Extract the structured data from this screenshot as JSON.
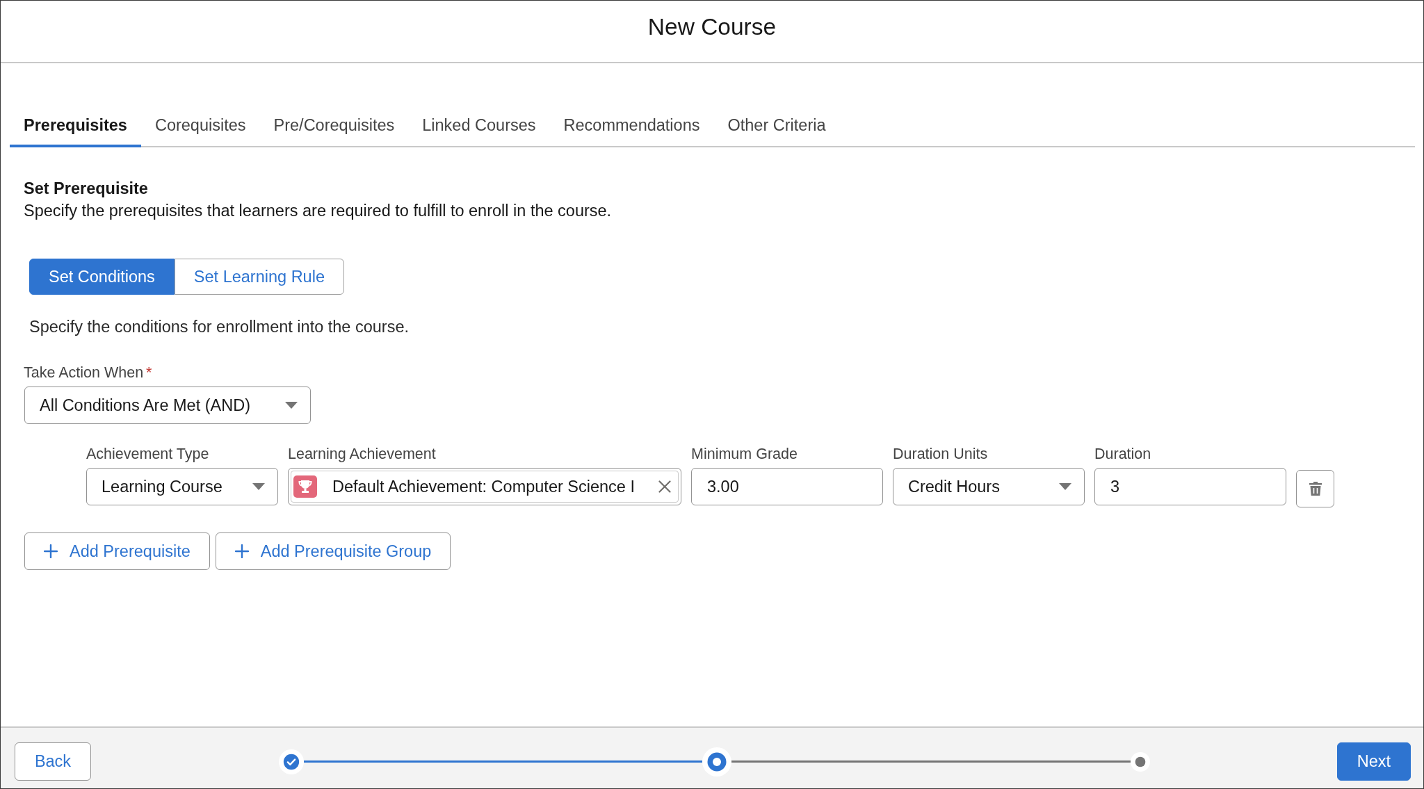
{
  "modal": {
    "title": "New Course"
  },
  "tabs": [
    {
      "label": "Prerequisites",
      "selected": true
    },
    {
      "label": "Corequisites",
      "selected": false
    },
    {
      "label": "Pre/Corequisites",
      "selected": false
    },
    {
      "label": "Linked Courses",
      "selected": false
    },
    {
      "label": "Recommendations",
      "selected": false
    },
    {
      "label": "Other Criteria",
      "selected": false
    }
  ],
  "section": {
    "title": "Set Prerequisite",
    "description": "Specify the prerequisites that learners are required to fulfill to enroll in the course."
  },
  "mode_toggle": [
    {
      "label": "Set Conditions",
      "selected": true
    },
    {
      "label": "Set Learning Rule",
      "selected": false
    }
  ],
  "conditions_hint": "Specify the conditions for enrollment into the course.",
  "take_action": {
    "label": "Take Action When",
    "required_mark": "*",
    "value": "All Conditions Are Met (AND)"
  },
  "condition_fields": [
    {
      "kind": "select",
      "label": "Achievement Type",
      "value": "Learning Course"
    },
    {
      "kind": "lookup",
      "label": "Learning Achievement",
      "value": "Default Achievement: Computer Science I"
    },
    {
      "kind": "input",
      "label": "Minimum Grade",
      "value": "3.00"
    },
    {
      "kind": "select",
      "label": "Duration Units",
      "value": "Credit Hours"
    },
    {
      "kind": "input",
      "label": "Duration",
      "value": "3"
    }
  ],
  "add_buttons": [
    {
      "label": "Add Prerequisite"
    },
    {
      "label": "Add Prerequisite Group"
    }
  ],
  "footer": {
    "back_button": "Back",
    "next_button": "Next",
    "steps": [
      {
        "completed": true,
        "selected": false
      },
      {
        "completed": false,
        "selected": true
      },
      {
        "completed": false,
        "selected": false
      }
    ]
  }
}
